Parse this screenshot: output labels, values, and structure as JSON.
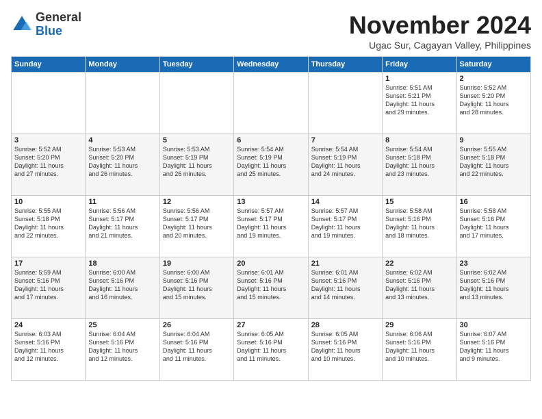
{
  "header": {
    "logo_line1": "General",
    "logo_line2": "Blue",
    "month": "November 2024",
    "location": "Ugac Sur, Cagayan Valley, Philippines"
  },
  "days_of_week": [
    "Sunday",
    "Monday",
    "Tuesday",
    "Wednesday",
    "Thursday",
    "Friday",
    "Saturday"
  ],
  "weeks": [
    [
      {
        "day": "",
        "info": ""
      },
      {
        "day": "",
        "info": ""
      },
      {
        "day": "",
        "info": ""
      },
      {
        "day": "",
        "info": ""
      },
      {
        "day": "",
        "info": ""
      },
      {
        "day": "1",
        "info": "Sunrise: 5:51 AM\nSunset: 5:21 PM\nDaylight: 11 hours\nand 29 minutes."
      },
      {
        "day": "2",
        "info": "Sunrise: 5:52 AM\nSunset: 5:20 PM\nDaylight: 11 hours\nand 28 minutes."
      }
    ],
    [
      {
        "day": "3",
        "info": "Sunrise: 5:52 AM\nSunset: 5:20 PM\nDaylight: 11 hours\nand 27 minutes."
      },
      {
        "day": "4",
        "info": "Sunrise: 5:53 AM\nSunset: 5:20 PM\nDaylight: 11 hours\nand 26 minutes."
      },
      {
        "day": "5",
        "info": "Sunrise: 5:53 AM\nSunset: 5:19 PM\nDaylight: 11 hours\nand 26 minutes."
      },
      {
        "day": "6",
        "info": "Sunrise: 5:54 AM\nSunset: 5:19 PM\nDaylight: 11 hours\nand 25 minutes."
      },
      {
        "day": "7",
        "info": "Sunrise: 5:54 AM\nSunset: 5:19 PM\nDaylight: 11 hours\nand 24 minutes."
      },
      {
        "day": "8",
        "info": "Sunrise: 5:54 AM\nSunset: 5:18 PM\nDaylight: 11 hours\nand 23 minutes."
      },
      {
        "day": "9",
        "info": "Sunrise: 5:55 AM\nSunset: 5:18 PM\nDaylight: 11 hours\nand 22 minutes."
      }
    ],
    [
      {
        "day": "10",
        "info": "Sunrise: 5:55 AM\nSunset: 5:18 PM\nDaylight: 11 hours\nand 22 minutes."
      },
      {
        "day": "11",
        "info": "Sunrise: 5:56 AM\nSunset: 5:17 PM\nDaylight: 11 hours\nand 21 minutes."
      },
      {
        "day": "12",
        "info": "Sunrise: 5:56 AM\nSunset: 5:17 PM\nDaylight: 11 hours\nand 20 minutes."
      },
      {
        "day": "13",
        "info": "Sunrise: 5:57 AM\nSunset: 5:17 PM\nDaylight: 11 hours\nand 19 minutes."
      },
      {
        "day": "14",
        "info": "Sunrise: 5:57 AM\nSunset: 5:17 PM\nDaylight: 11 hours\nand 19 minutes."
      },
      {
        "day": "15",
        "info": "Sunrise: 5:58 AM\nSunset: 5:16 PM\nDaylight: 11 hours\nand 18 minutes."
      },
      {
        "day": "16",
        "info": "Sunrise: 5:58 AM\nSunset: 5:16 PM\nDaylight: 11 hours\nand 17 minutes."
      }
    ],
    [
      {
        "day": "17",
        "info": "Sunrise: 5:59 AM\nSunset: 5:16 PM\nDaylight: 11 hours\nand 17 minutes."
      },
      {
        "day": "18",
        "info": "Sunrise: 6:00 AM\nSunset: 5:16 PM\nDaylight: 11 hours\nand 16 minutes."
      },
      {
        "day": "19",
        "info": "Sunrise: 6:00 AM\nSunset: 5:16 PM\nDaylight: 11 hours\nand 15 minutes."
      },
      {
        "day": "20",
        "info": "Sunrise: 6:01 AM\nSunset: 5:16 PM\nDaylight: 11 hours\nand 15 minutes."
      },
      {
        "day": "21",
        "info": "Sunrise: 6:01 AM\nSunset: 5:16 PM\nDaylight: 11 hours\nand 14 minutes."
      },
      {
        "day": "22",
        "info": "Sunrise: 6:02 AM\nSunset: 5:16 PM\nDaylight: 11 hours\nand 13 minutes."
      },
      {
        "day": "23",
        "info": "Sunrise: 6:02 AM\nSunset: 5:16 PM\nDaylight: 11 hours\nand 13 minutes."
      }
    ],
    [
      {
        "day": "24",
        "info": "Sunrise: 6:03 AM\nSunset: 5:16 PM\nDaylight: 11 hours\nand 12 minutes."
      },
      {
        "day": "25",
        "info": "Sunrise: 6:04 AM\nSunset: 5:16 PM\nDaylight: 11 hours\nand 12 minutes."
      },
      {
        "day": "26",
        "info": "Sunrise: 6:04 AM\nSunset: 5:16 PM\nDaylight: 11 hours\nand 11 minutes."
      },
      {
        "day": "27",
        "info": "Sunrise: 6:05 AM\nSunset: 5:16 PM\nDaylight: 11 hours\nand 11 minutes."
      },
      {
        "day": "28",
        "info": "Sunrise: 6:05 AM\nSunset: 5:16 PM\nDaylight: 11 hours\nand 10 minutes."
      },
      {
        "day": "29",
        "info": "Sunrise: 6:06 AM\nSunset: 5:16 PM\nDaylight: 11 hours\nand 10 minutes."
      },
      {
        "day": "30",
        "info": "Sunrise: 6:07 AM\nSunset: 5:16 PM\nDaylight: 11 hours\nand 9 minutes."
      }
    ]
  ]
}
